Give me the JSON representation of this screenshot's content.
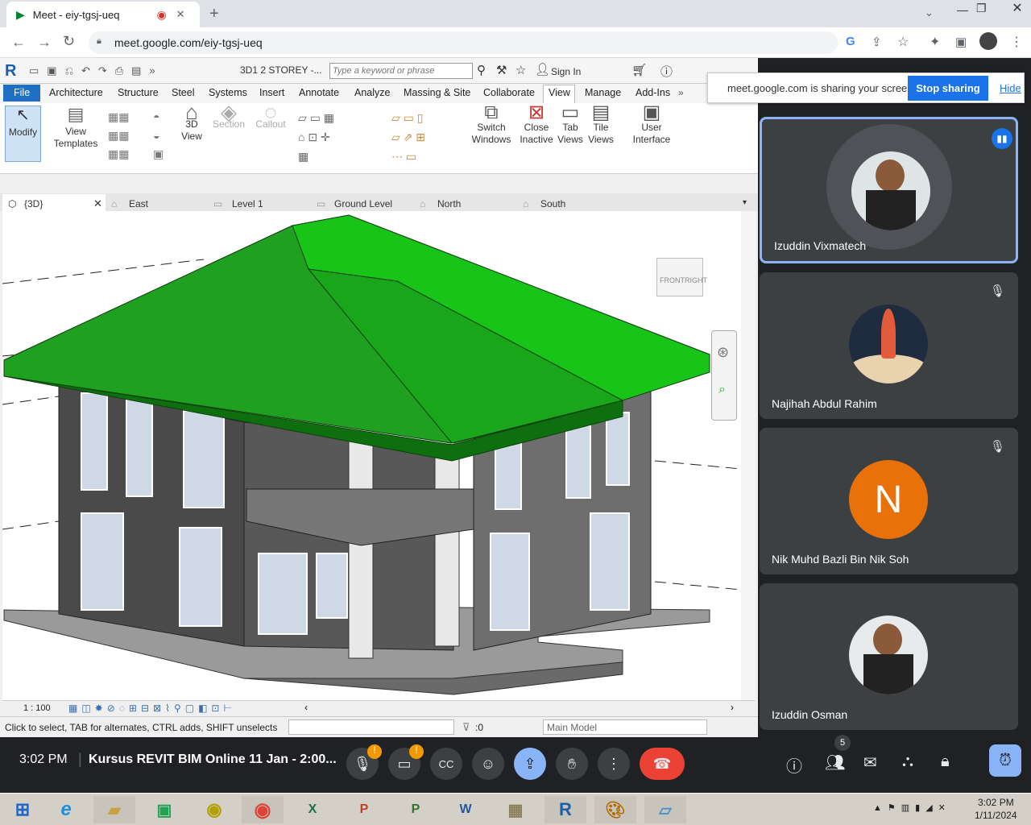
{
  "browser": {
    "tab_title": "Meet - eiy-tgsj-ueq",
    "url": "meet.google.com/eiy-tgsj-ueq"
  },
  "revit": {
    "project": "3D1 2 STOREY -...",
    "search_placeholder": "Type a keyword or phrase",
    "sign_in": "Sign In",
    "ribbon_tabs": [
      "File",
      "Architecture",
      "Structure",
      "Steel",
      "Systems",
      "Insert",
      "Annotate",
      "Analyze",
      "Massing & Site",
      "Collaborate",
      "View",
      "Manage",
      "Add-Ins"
    ],
    "buttons": {
      "modify": "Modify",
      "view_templates": "View Templates",
      "view3d": "3D View",
      "section": "Section",
      "callout": "Callout",
      "switch_windows": "Switch Windows",
      "close_inactive": "Close Inactive",
      "tab_views": "Tab Views",
      "tile_views": "Tile Views",
      "user_interface": "User Interface"
    },
    "view_tabs": [
      "{3D}",
      "East",
      "Level 1",
      "Ground Level",
      "North",
      "South"
    ],
    "scale": "1 : 100",
    "status_text": "Click to select, TAB for alternates, CTRL adds, SHIFT unselects",
    "selection_count": ":0",
    "model": "Main Model",
    "viewcube": {
      "front": "FRONT",
      "right": "RIGHT"
    }
  },
  "share_banner": {
    "text": "meet.google.com is sharing your screen.",
    "stop": "Stop sharing",
    "hide": "Hide"
  },
  "participants": [
    {
      "name": "Izuddin Vixmatech",
      "speaking": true
    },
    {
      "name": "Najihah Abdul Rahim",
      "muted": true
    },
    {
      "name": "Nik Muhd Bazli Bin Nik Soh",
      "muted": true,
      "initial": "N"
    },
    {
      "name": "Izuddin Osman"
    }
  ],
  "meeting": {
    "time": "3:02 PM",
    "title": "Kursus REVIT BIM Online 11 Jan - 2:00...",
    "people_count": "5"
  },
  "taskbar": {
    "time": "3:02 PM",
    "date": "1/11/2024"
  },
  "colors": {
    "roof": "#1f9a1f",
    "accent": "#1a73e8",
    "end_call": "#ea4335",
    "avatar_n": "#e8710a"
  }
}
